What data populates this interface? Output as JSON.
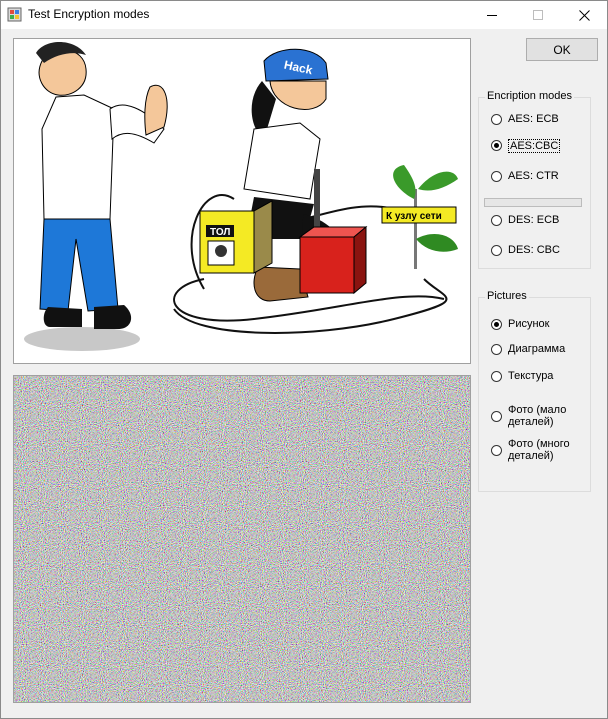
{
  "window": {
    "title": "Test Encryption modes"
  },
  "buttons": {
    "ok": "OK"
  },
  "encryption_group": {
    "legend": "Encription modes",
    "options": [
      "AES: ECB",
      "AES:CBC",
      "AES: CTR",
      "DES: ECB",
      "DES: CBC"
    ],
    "selected": "AES:CBC",
    "progress": 0
  },
  "pictures_group": {
    "legend": "Pictures",
    "options": [
      "Рисунок",
      "Диаграмма",
      "Текстура",
      "Фото (мало деталей)",
      "Фото (много деталей)"
    ],
    "selected": "Рисунок"
  },
  "source_picture": {
    "hat_text": "Hack",
    "box_text": "ТОЛ",
    "sign_text": "К узлу сети"
  },
  "colors": {
    "window_bg": "#f0f0f0",
    "selection": "#000000"
  },
  "icons": [
    "app-icon",
    "minimize-icon",
    "maximize-icon",
    "close-icon"
  ]
}
